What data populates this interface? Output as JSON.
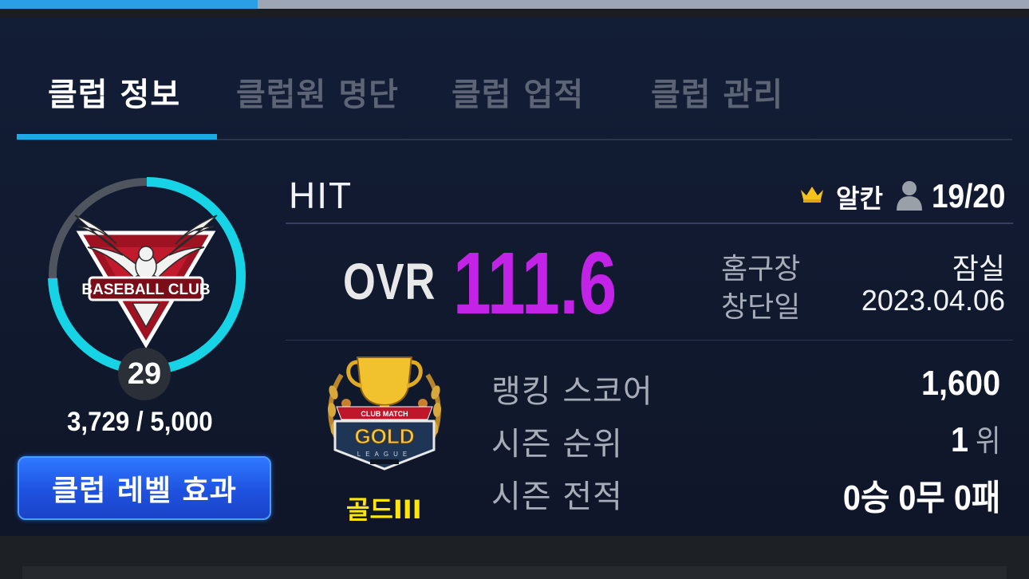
{
  "top_progress": {
    "fraction": 0.25
  },
  "tabs": [
    {
      "label": "클럽 정보",
      "active": true
    },
    {
      "label": "클럽원 명단",
      "active": false
    },
    {
      "label": "클럽 업적",
      "active": false
    },
    {
      "label": "클럽 관리",
      "active": false
    }
  ],
  "club": {
    "emblem_text": "BASEBALL CLUB",
    "level": "29",
    "exp": "3,729 / 5,000",
    "exp_fraction": 0.7458,
    "level_effect_button": "클럽 레벨 효과",
    "name": "HIT",
    "master_name": "알칸",
    "members": "19/20",
    "ovr_label": "OVR",
    "ovr_value": "111.6",
    "info": [
      {
        "label": "홈구장",
        "value": "잠실"
      },
      {
        "label": "창단일",
        "value": "2023.04.06"
      }
    ],
    "league": {
      "badge_top_text": "CLUB MATCH",
      "badge_main_text": "GOLD",
      "badge_sub_text": "LEAGUE",
      "tier": "골드III"
    },
    "stats": {
      "ranking_score": {
        "label": "랭킹 스코어",
        "value": "1,600"
      },
      "season_rank": {
        "label": "시즌 순위",
        "value": "1",
        "unit": "위"
      },
      "season_record": {
        "label": "시즌 전적",
        "value": "0승 0무 0패"
      }
    }
  },
  "colors": {
    "accent_blue": "#1ea8e8",
    "ovr_purple": "#c323e6",
    "tier_yellow": "#ffe60a",
    "ring_cyan": "#17d3e6"
  },
  "icons": [
    "crown-icon",
    "person-icon",
    "club-emblem",
    "gold-league-trophy"
  ]
}
